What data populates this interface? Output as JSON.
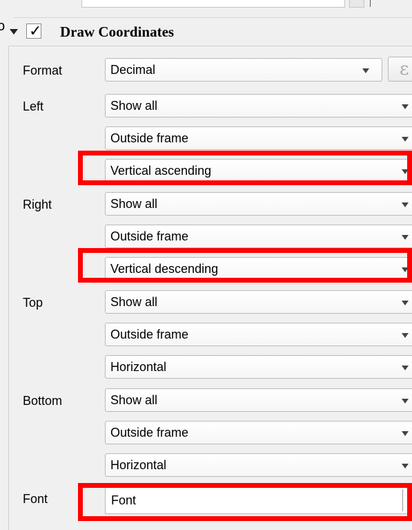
{
  "header_glyph": "o",
  "group": {
    "title": "Draw Coordinates",
    "checked_mark": "✓"
  },
  "expression_icon": "ε",
  "rows": [
    {
      "label": "Format",
      "value": "Decimal"
    },
    {
      "label": "Left",
      "value": "Show all"
    },
    {
      "label": "",
      "value": "Outside frame"
    },
    {
      "label": "",
      "value": "Vertical ascending"
    },
    {
      "label": "Right",
      "value": "Show all"
    },
    {
      "label": "",
      "value": "Outside frame"
    },
    {
      "label": "",
      "value": "Vertical descending"
    },
    {
      "label": "Top",
      "value": "Show all"
    },
    {
      "label": "",
      "value": "Outside frame"
    },
    {
      "label": "",
      "value": "Horizontal"
    },
    {
      "label": "Bottom",
      "value": "Show all"
    },
    {
      "label": "",
      "value": "Outside frame"
    },
    {
      "label": "",
      "value": "Horizontal"
    }
  ],
  "font": {
    "label": "Font",
    "value": "Font"
  },
  "highlight_color": "#ff0000"
}
